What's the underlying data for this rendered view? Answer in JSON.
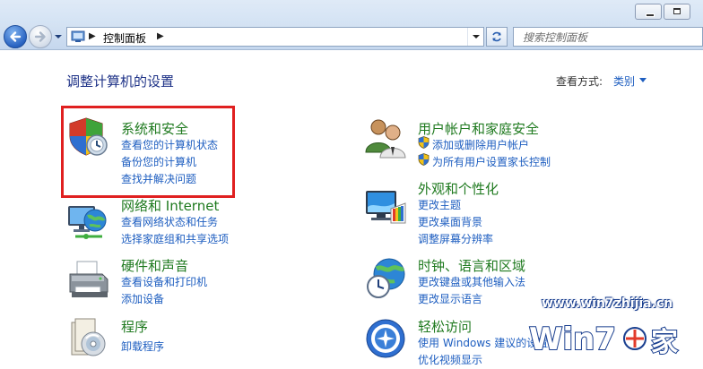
{
  "window": {
    "minimize_icon": "minimize-icon",
    "maximize_icon": "maximize-icon"
  },
  "nav": {
    "breadcrumb": "控制面板",
    "search_placeholder": "搜索控制面板"
  },
  "main": {
    "title": "调整计算机的设置",
    "view_by_label": "查看方式:",
    "view_by_value": "类别"
  },
  "categories": {
    "system": {
      "title": "系统和安全",
      "links": [
        "查看您的计算机状态",
        "备份您的计算机",
        "查找并解决问题"
      ]
    },
    "network": {
      "title": "网络和 Internet",
      "links": [
        "查看网络状态和任务",
        "选择家庭组和共享选项"
      ]
    },
    "hardware": {
      "title": "硬件和声音",
      "links": [
        "查看设备和打印机",
        "添加设备"
      ]
    },
    "programs": {
      "title": "程序",
      "links": [
        "卸载程序"
      ]
    },
    "users": {
      "title": "用户帐户和家庭安全",
      "links": [
        "添加或删除用户帐户",
        "为所有用户设置家长控制"
      ]
    },
    "appearance": {
      "title": "外观和个性化",
      "links": [
        "更改主题",
        "更改桌面背景",
        "调整屏幕分辨率"
      ]
    },
    "clock": {
      "title": "时钟、语言和区域",
      "links": [
        "更改键盘或其他输入法",
        "更改显示语言"
      ]
    },
    "ease": {
      "title": "轻松访问",
      "links": [
        "使用 Windows 建议的设置",
        "优化视频显示"
      ]
    }
  },
  "watermark": {
    "url": "www.win7zhijia.cn",
    "logo_text": "Win7之家"
  },
  "colors": {
    "category_title": "#1f7a1f",
    "link": "#1e5ec0",
    "highlight": "#e02020"
  }
}
